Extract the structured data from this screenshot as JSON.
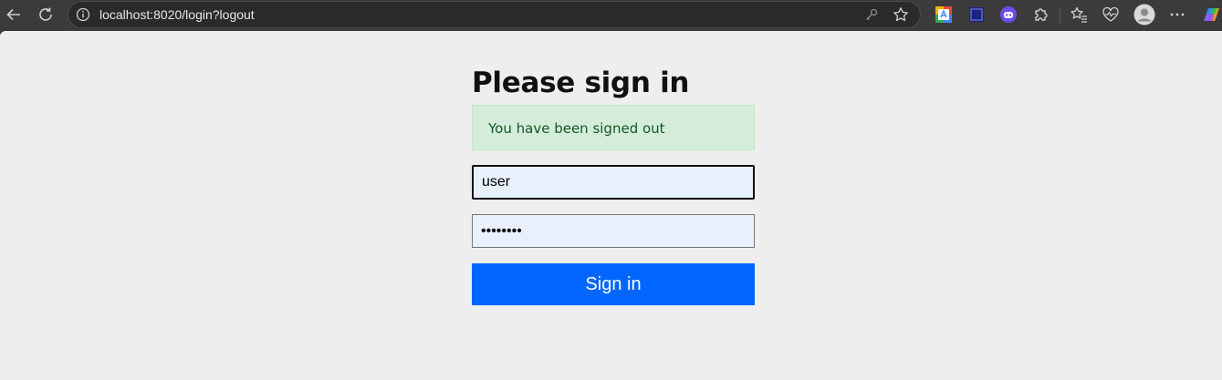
{
  "browser": {
    "url": "localhost:8020/login?logout",
    "icons": {
      "back": "back-arrow-icon",
      "reload": "reload-icon",
      "info": "info-icon",
      "key": "key-icon",
      "favorite": "star-icon",
      "extensions": [
        "translate-extension-icon",
        "square-extension-icon",
        "bot-extension-icon",
        "puzzle-icon"
      ],
      "favorites": "favorites-icon",
      "health": "browser-essentials-icon",
      "profile": "profile-avatar-icon",
      "more": "more-options-icon",
      "copilot": "copilot-icon"
    }
  },
  "login": {
    "heading": "Please sign in",
    "alert": "You have been signed out",
    "username_value": "user",
    "password_value": "password",
    "submit_label": "Sign in"
  },
  "colors": {
    "page_background": "#eeeeee",
    "alert_background": "#d4edda",
    "alert_text": "#155724",
    "input_background": "#e8f0fe",
    "button": "#0066ff"
  }
}
